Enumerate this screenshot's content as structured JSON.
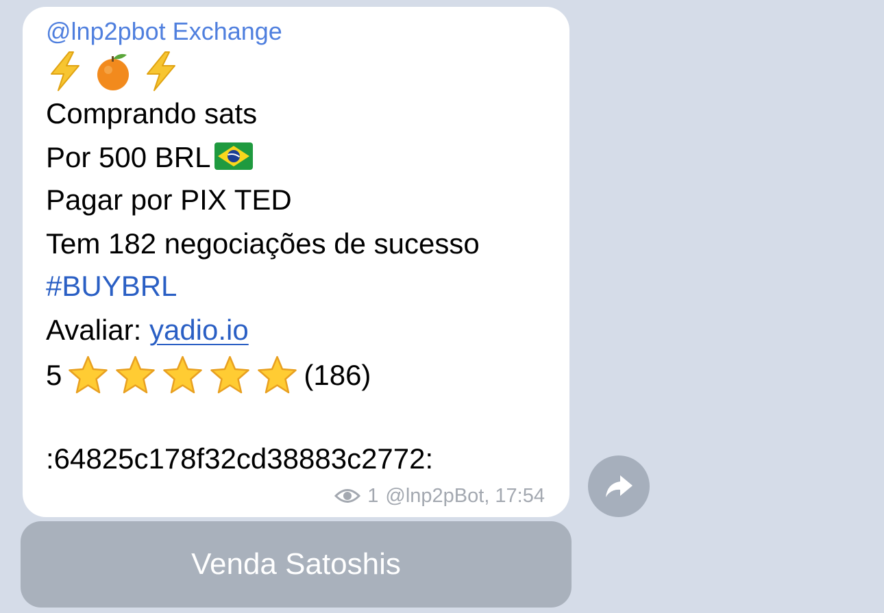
{
  "message": {
    "sender": "@lnp2pbot Exchange",
    "emoji_header": [
      "lightning-icon",
      "tangerine-icon",
      "lightning-icon"
    ],
    "line_buying": "Comprando sats",
    "line_amount": "Por 500 BRL",
    "flag_icon": "brazil-flag-icon",
    "line_payment": "Pagar por PIX TED",
    "line_trades": "Tem 182 negociações de sucesso",
    "hashtag": "#BUYBRL",
    "rate_label": "Avaliar: ",
    "rate_link": "yadio.io",
    "rating_value": "5",
    "rating_stars": 5,
    "rating_count": "(186)",
    "order_id": ":64825c178f32cd38883c2772:",
    "views": "1",
    "author_time": "@lnp2pBot, 17:54"
  },
  "share_button": {
    "icon": "share-arrow-icon"
  },
  "keyboard": {
    "button_label": "Venda Satoshis"
  },
  "colors": {
    "background": "#d5dce8",
    "bubble": "#ffffff",
    "sender": "#4f7fde",
    "link": "#2a5fc4",
    "meta": "#a3a8b0",
    "button": "#a9b1bc"
  }
}
